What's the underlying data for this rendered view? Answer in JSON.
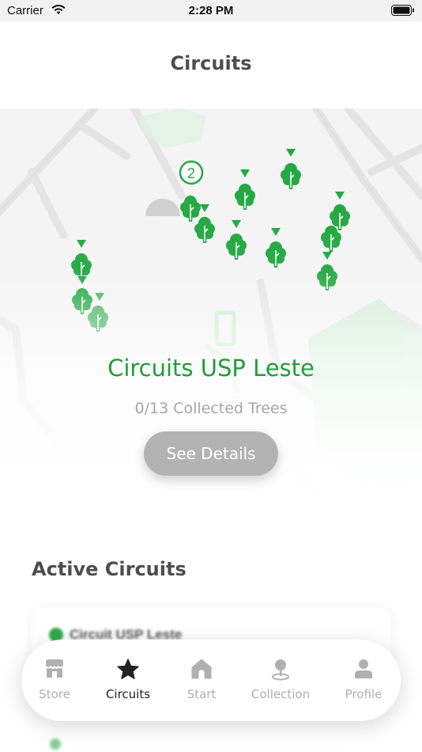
{
  "status_bar": {
    "carrier": "Carrier",
    "time": "2:28 PM"
  },
  "nav": {
    "title": "Circuits"
  },
  "map": {
    "cluster_count": "2"
  },
  "featured_circuit": {
    "name": "Circuits USP Leste",
    "collected_text": "0/13 Collected Trees",
    "button_label": "See Details"
  },
  "active_circuits": {
    "title": "Active Circuits",
    "items": [
      {
        "name": "Circuit USP Leste"
      }
    ]
  },
  "tabbar": {
    "items": [
      {
        "label": "Store",
        "icon": "store-icon",
        "active": false
      },
      {
        "label": "Circuits",
        "icon": "star-icon",
        "active": true
      },
      {
        "label": "Start",
        "icon": "home-icon",
        "active": false
      },
      {
        "label": "Collection",
        "icon": "map-pin-icon",
        "active": false
      },
      {
        "label": "Profile",
        "icon": "person-icon",
        "active": false
      }
    ]
  },
  "colors": {
    "accent_green": "#1e9e3a",
    "tree_green": "#1fa63f",
    "button_gray": "#b3b3b3"
  }
}
